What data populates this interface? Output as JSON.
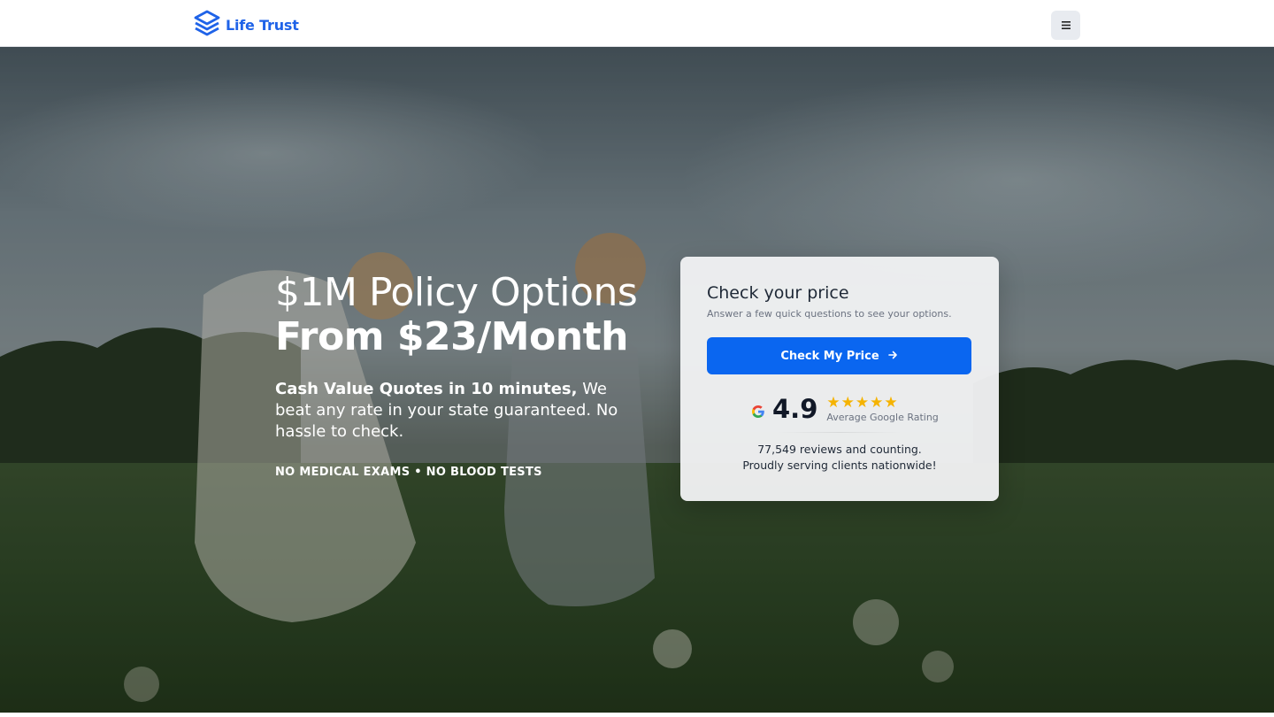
{
  "header": {
    "brand_name": "Life Trust",
    "logo_icon": "stacked-layers-icon",
    "menu_icon": "hamburger-menu-icon",
    "brand_color": "#1f63e8"
  },
  "hero": {
    "title_line1": "$1M Policy Options",
    "title_line2": "From $23/Month",
    "subtitle_bold": "Cash Value Quotes in 10 minutes,",
    "subtitle_rest": " We beat any rate in your state guaranteed. No hassle to check.",
    "badges": "NO MEDICAL EXAMS • NO BLOOD TESTS"
  },
  "quote_card": {
    "title": "Check your price",
    "subtitle": "Answer a few quick questions to see your options.",
    "cta_label": "Check My Price",
    "cta_icon": "arrow-right-icon",
    "cta_color": "#0a66f0",
    "rating_value": "4.9",
    "rating_stars": 5,
    "rating_label": "Average Google Rating",
    "google_icon": "google-g-icon",
    "reviews_line1": "77,549 reviews and counting.",
    "reviews_line2": "Proudly serving clients nationwide!"
  }
}
